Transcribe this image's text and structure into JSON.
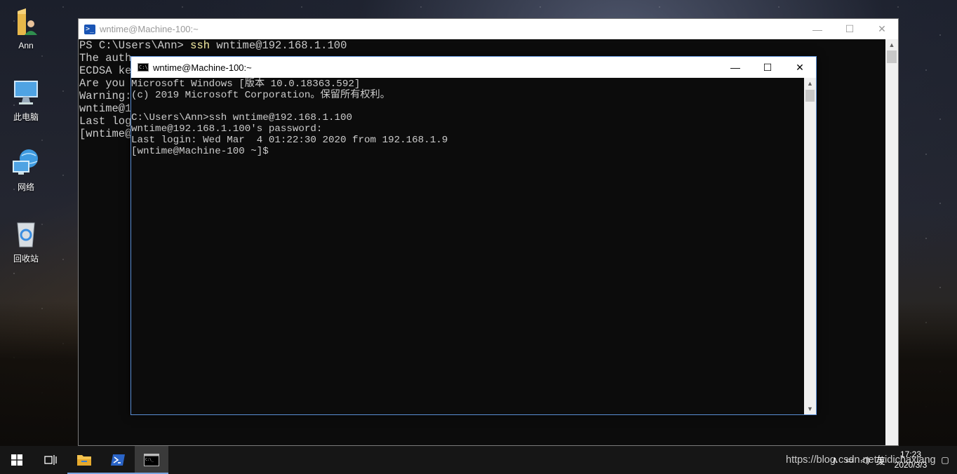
{
  "desktop": {
    "icons": [
      {
        "label": "Ann",
        "icon": "user-folder-icon"
      },
      {
        "label": "此电脑",
        "icon": "this-pc-icon"
      },
      {
        "label": "网络",
        "icon": "network-icon"
      },
      {
        "label": "回收站",
        "icon": "recycle-bin-icon"
      }
    ]
  },
  "powershell_window": {
    "title": "wntime@Machine-100:~",
    "icon": "powershell-icon",
    "lines": {
      "l1_prompt": "PS C:\\Users\\Ann> ",
      "l1_cmd": "ssh",
      "l1_args": " wntime@192.168.1.100",
      "l2": "The auth",
      "l3": "ECDSA ke",
      "l4": "Are you ",
      "l5": "Warning:",
      "l6": "wntime@1",
      "l7": "Last log",
      "l8": "[wntime@"
    }
  },
  "cmd_window": {
    "title": "wntime@Machine-100:~",
    "icon": "cmd-icon",
    "lines": [
      "Microsoft Windows [版本 10.0.18363.592]",
      "(c) 2019 Microsoft Corporation。保留所有权利。",
      "",
      "C:\\Users\\Ann>ssh wntime@192.168.1.100",
      "wntime@192.168.1.100's password:",
      "Last login: Wed Mar  4 01:22:30 2020 from 192.168.1.9",
      "[wntime@Machine-100 ~]$"
    ]
  },
  "window_controls": {
    "minimize": "—",
    "maximize": "☐",
    "close": "✕"
  },
  "taskbar": {
    "items": [
      {
        "name": "start-button",
        "icon": "windows-logo-icon"
      },
      {
        "name": "task-view-button",
        "icon": "task-view-icon"
      },
      {
        "name": "file-explorer-button",
        "icon": "folder-icon"
      },
      {
        "name": "powershell-button",
        "icon": "powershell-icon"
      },
      {
        "name": "cmd-button",
        "icon": "cmd-icon",
        "active": true
      }
    ],
    "tray": {
      "ime": "英",
      "time": "17:23",
      "date": "2020/3/3"
    }
  },
  "watermark": "https://blog.csdn.net/yidichaxiang",
  "colors": {
    "accent": "#5b8fd6",
    "terminal_bg": "#0c0c0c",
    "ps_yellow": "#f9f1a5"
  }
}
